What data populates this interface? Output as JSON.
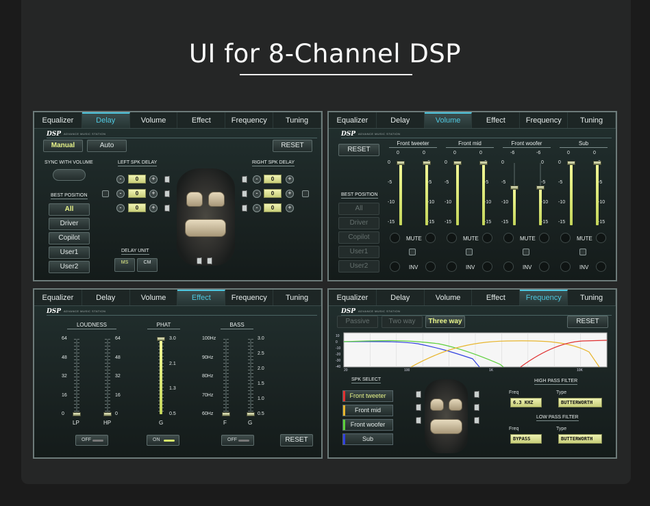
{
  "title": "UI for 8-Channel DSP",
  "tabs": [
    "Equalizer",
    "Delay",
    "Volume",
    "Effect",
    "Frequency",
    "Tuning"
  ],
  "brand": {
    "name": "DSP",
    "subtitle": "ADVANCE MUSIC STATION"
  },
  "delay_panel": {
    "active_tab": "Delay",
    "mode_buttons": [
      "Manual",
      "Auto"
    ],
    "mode_selected": "Manual",
    "reset": "RESET",
    "sync_label": "SYNC WITH VOLUME",
    "best_position_label": "BEST POSITION",
    "positions": [
      "All",
      "Driver",
      "Copilot",
      "User1",
      "User2"
    ],
    "position_selected": "All",
    "left_label": "LEFT SPK DELAY",
    "right_label": "RIGHT SPK DELAY",
    "left_values": [
      "0",
      "0",
      "0"
    ],
    "right_values": [
      "0",
      "0",
      "0"
    ],
    "delay_unit_label": "DELAY UNIT",
    "units": [
      "MS",
      "CM"
    ],
    "unit_selected": "MS"
  },
  "volume_panel": {
    "active_tab": "Volume",
    "reset": "RESET",
    "best_position_label": "BEST POSITION",
    "positions": [
      "All",
      "Driver",
      "Copilot",
      "User1",
      "User2"
    ],
    "groups": [
      {
        "name": "Front tweeter",
        "left": "0",
        "right": "0"
      },
      {
        "name": "Front mid",
        "left": "0",
        "right": "0"
      },
      {
        "name": "Front woofer",
        "left": "-6",
        "right": "-6"
      },
      {
        "name": "Sub",
        "left": "0",
        "right": "0"
      }
    ],
    "scale": [
      "0",
      "-5",
      "-10",
      "-15"
    ],
    "mute": "MUTE",
    "inv": "INV"
  },
  "effect_panel": {
    "active_tab": "Effect",
    "loudness": {
      "label": "LOUDNESS",
      "scale": [
        "64",
        "48",
        "32",
        "16",
        "0"
      ],
      "channels": [
        "LP",
        "HP"
      ],
      "toggle": "OFF"
    },
    "phat": {
      "label": "PHAT",
      "scale": [
        "3.0",
        "2.1",
        "1.3",
        "0.5"
      ],
      "channel": "G",
      "toggle": "ON"
    },
    "bass": {
      "label": "BASS",
      "freq_scale": [
        "100Hz",
        "90Hz",
        "80Hz",
        "70Hz",
        "60Hz"
      ],
      "gain_scale": [
        "3.0",
        "2.5",
        "2.0",
        "1.5",
        "1.0",
        "0.5"
      ],
      "channels": [
        "F",
        "G"
      ],
      "toggle": "OFF"
    },
    "reset": "RESET"
  },
  "frequency_panel": {
    "active_tab": "Frequency",
    "modes": [
      "Passive",
      "Two way",
      "Three way"
    ],
    "mode_selected": "Three way",
    "reset": "RESET",
    "graph_y": [
      "10",
      "0",
      "-10",
      "-20",
      "-30",
      "-40"
    ],
    "graph_x": [
      "20",
      "100",
      "1K",
      "10K"
    ],
    "spk_select_label": "SPK SELECT",
    "speakers": [
      {
        "name": "Front tweeter",
        "color": "#e03030"
      },
      {
        "name": "Front mid",
        "color": "#e8b52c"
      },
      {
        "name": "Front woofer",
        "color": "#5ccf3a"
      },
      {
        "name": "Sub",
        "color": "#2f3fe0"
      }
    ],
    "speaker_selected": "Front tweeter",
    "hpf": {
      "label": "HIGH PASS FILTER",
      "freq_label": "Freq",
      "freq": "6.3 KHZ",
      "type_label": "Type",
      "type": "BUTTERWORTH"
    },
    "lpf": {
      "label": "LOW PASS FILTER",
      "freq_label": "Freq",
      "freq": "BYPASS",
      "type_label": "Type",
      "type": "BUTTERWORTH"
    }
  }
}
